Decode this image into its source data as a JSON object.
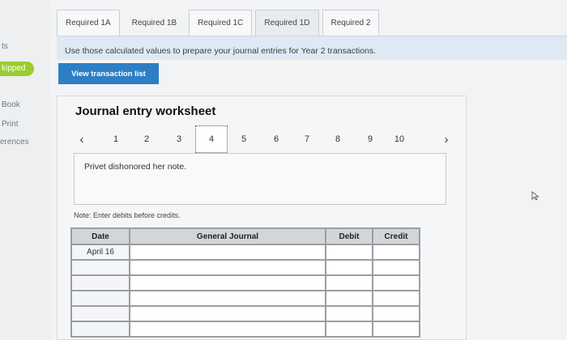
{
  "sidebar": {
    "items": [
      "ts",
      "kipped",
      "Book",
      "Print",
      "erences"
    ]
  },
  "tabs": [
    "Required 1A",
    "Required 1B",
    "Required 1C",
    "Required 1D",
    "Required 2"
  ],
  "instruction": "Use those calculated values to prepare your journal entries for Year 2 transactions.",
  "view_button": "View transaction list",
  "worksheet": {
    "title": "Journal entry worksheet",
    "prev_icon": "chevron-left-icon",
    "next_icon": "chevron-right-icon",
    "pages": [
      "1",
      "2",
      "3",
      "4",
      "5",
      "6",
      "7",
      "8",
      "9",
      "10"
    ],
    "current_page": "4",
    "description": "Privet dishonored her note.",
    "note": "Note: Enter debits before credits."
  },
  "journal": {
    "headers": {
      "date": "Date",
      "general_journal": "General Journal",
      "debit": "Debit",
      "credit": "Credit"
    },
    "rows": [
      {
        "date": "April 16"
      },
      {
        "date": ""
      },
      {
        "date": ""
      },
      {
        "date": ""
      },
      {
        "date": ""
      },
      {
        "date": ""
      }
    ]
  },
  "colors": {
    "skipped_badge": "#9acd2e",
    "primary_button": "#2d7ec4",
    "banner": "#dfe9f3"
  }
}
